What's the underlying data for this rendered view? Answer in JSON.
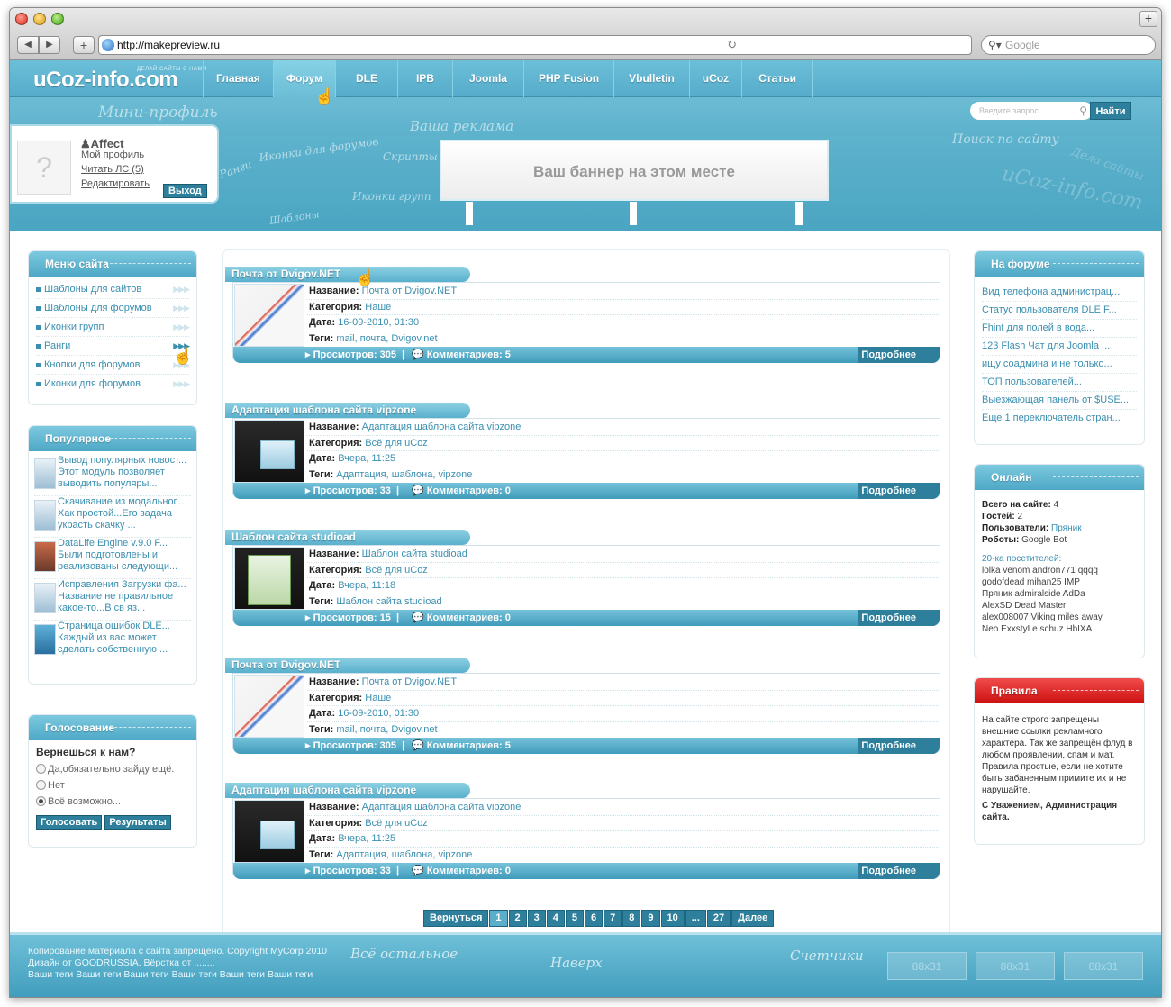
{
  "browser": {
    "url": "http://makepreview.ru",
    "search_placeholder": "Google"
  },
  "site": {
    "logo": "uCoz-info.com",
    "slogan": "ДЕЛАЙ САЙТЫ С НАМИ",
    "menu": [
      "Главная",
      "Форум",
      "DLE",
      "IPB",
      "Joomla",
      "PHP Fusion",
      "Vbulletin",
      "uCoz",
      "Статьи"
    ],
    "active_menu": "Форум",
    "handwriting": [
      "Мини-профиль",
      "Иконки для форумов",
      "Ваша реклама",
      "Скрипты",
      "Ранги",
      "Иконки групп",
      "Шаблоны",
      "Поиск по сайту",
      "uCoz-info.com",
      "Дела сайты"
    ],
    "search_placeholder": "Введите запрос",
    "search_button": "Найти",
    "banner_text": "Ваш баннер на этом месте"
  },
  "miniprofile": {
    "username": "Affect",
    "links": [
      "Мой профиль",
      "Читать ЛС (5)",
      "Редактировать"
    ],
    "logout": "Выход"
  },
  "left": {
    "menu_title": "Меню сайта",
    "menu_items": [
      "Шаблоны для сайтов",
      "Шаблоны для форумов",
      "Иконки групп",
      "Ранги",
      "Кнопки для форумов",
      "Иконки для форумов"
    ],
    "popular_title": "Популярное",
    "popular": [
      {
        "l1": "Вывод популярных новост...",
        "l2": "Этот модуль позволяет",
        "l3": "выводить популяры..."
      },
      {
        "l1": "Скачивание из модальног...",
        "l2": "Хак простой...Его задача",
        "l3": "украсть скачку ..."
      },
      {
        "l1": "DataLife Engine v.9.0 F...",
        "l2": "Были подготовлены и",
        "l3": "реализованы следующи..."
      },
      {
        "l1": "Исправления Загрузки фа...",
        "l2": "Название не правильное",
        "l3": "какое-то...В св яз..."
      },
      {
        "l1": "Страница ошибок DLE...",
        "l2": "Каждый из вас может",
        "l3": "сделать собственную ..."
      }
    ],
    "vote_title": "Голосование",
    "vote_question": "Вернешься к нам?",
    "vote_options": [
      "Да,обязательно зайду ещё.",
      "Нет",
      "Всё возможно..."
    ],
    "vote_selected": 2,
    "vote_button": "Голосовать",
    "results_button": "Результаты"
  },
  "labels": {
    "name": "Название:",
    "category": "Категория:",
    "date": "Дата:",
    "tags": "Теги:",
    "views": "Просмотров:",
    "comments": "Комментариев:",
    "more": "Подробнее"
  },
  "news": [
    {
      "title": "Почта от Dvigov.NET",
      "name": "Почта от Dvigov.NET",
      "category": "Наше",
      "date": "16-09-2010, 01:30",
      "tags": "mail, почта, Dvigov.net",
      "views": "305",
      "comments": "5",
      "thumb": "mail"
    },
    {
      "title": "Адаптация шаблона сайта vipzone",
      "name": "Адаптация шаблона сайта vipzone",
      "category": "Всё для uCoz",
      "date": "Вчера, 11:25",
      "tags": "Адаптация, шаблона, vipzone",
      "views": "33",
      "comments": "0",
      "thumb": "shot"
    },
    {
      "title": "Шаблон сайта studioad",
      "name": "Шаблон сайта studioad",
      "category": "Всё для uCoz",
      "date": "Вчера, 11:18",
      "tags": "Шаблон сайта studioad",
      "views": "15",
      "comments": "0",
      "thumb": "green"
    },
    {
      "title": "Почта от Dvigov.NET",
      "name": "Почта от Dvigov.NET",
      "category": "Наше",
      "date": "16-09-2010, 01:30",
      "tags": "mail, почта, Dvigov.net",
      "views": "305",
      "comments": "5",
      "thumb": "mail"
    },
    {
      "title": "Адаптация шаблона сайта vipzone",
      "name": "Адаптация шаблона сайта vipzone",
      "category": "Всё для uCoz",
      "date": "Вчера, 11:25",
      "tags": "Адаптация, шаблона, vipzone",
      "views": "33",
      "comments": "0",
      "thumb": "shot"
    }
  ],
  "pager": {
    "prev": "Вернуться",
    "pages": [
      "1",
      "2",
      "3",
      "4",
      "5",
      "6",
      "7",
      "8",
      "9",
      "10",
      "...",
      "27"
    ],
    "next": "Далее"
  },
  "right": {
    "forum_title": "На форуме",
    "forum_items": [
      "Вид телефона администрац...",
      "Статус пользователя DLE F...",
      "Fhint для полей в вода...",
      "123 Flash Чат для Joomla ...",
      "ищу соадмина и не только...",
      "ТОП пользователей...",
      "Выезжающая панель от $USE...",
      "Еще 1 переключатель стран..."
    ],
    "online_title": "Онлайн",
    "online": {
      "total_label": "Всего на сайте:",
      "total": "4",
      "guests_label": "Гостей:",
      "guests": "2",
      "users_label": "Пользователи:",
      "users": "Пряник",
      "robots_label": "Роботы:",
      "robots": "Google Bot",
      "visitors_title": "20-ка посетителей:",
      "visitors": [
        "lolka venom andron771 qqqq",
        "godofdead mihan25 IMP",
        "Пряник admiralside AdDa",
        "AlexSD Dead Master",
        "alex008007 Viking miles away",
        "Neo ExxstyLe schuz HbIXA"
      ]
    },
    "rules_title": "Правила",
    "rules_text": "На сайте строго запрещены внешние ссылки рекламного характера. Так же запрещён флуд в любом проявлении, спам и мат. Правила простые, если не хотите быть забаненным примите их и не нарушайте.",
    "rules_sign": "С Уважением, Администрация сайта."
  },
  "footer": {
    "copy": [
      "Копирование материала с сайта запрещено. Copyright MyCorp 2010",
      "Дизайн от GOODRUSSIA. Вёрстка от ........",
      "Ваши теги Ваши теги Ваши теги Ваши теги Ваши теги Ваши теги"
    ],
    "hand": [
      "Всё остальное",
      "Наверх",
      "Счетчики"
    ],
    "counters": [
      "88x31",
      "88x31",
      "88x31"
    ]
  }
}
